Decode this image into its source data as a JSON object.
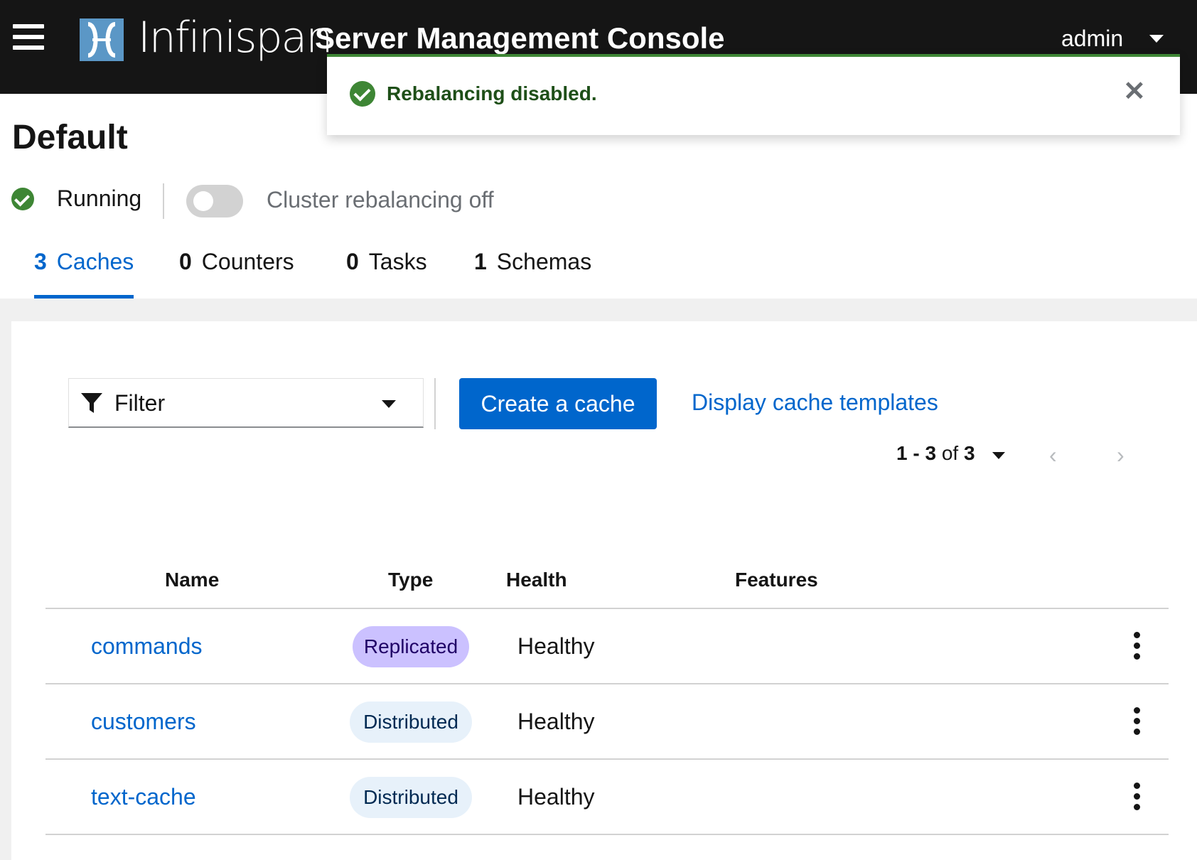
{
  "header": {
    "brand": "Infinispan",
    "title": "Server Management Console",
    "user": "admin",
    "menu_icon": "hamburger-icon",
    "logo_icon": "infinispan-logo-icon"
  },
  "alert": {
    "title": "Rebalancing disabled.",
    "close_symbol": "✕",
    "variant_color": "#3e8635"
  },
  "cluster": {
    "name": "Default",
    "status": "Running",
    "rebalancing_label": "Cluster rebalancing off",
    "rebalancing_enabled": false
  },
  "tabs": [
    {
      "count": "3",
      "label": "Caches",
      "active": true
    },
    {
      "count": "0",
      "label": "Counters",
      "active": false
    },
    {
      "count": "0",
      "label": "Tasks",
      "active": false
    },
    {
      "count": "1",
      "label": "Schemas",
      "active": false
    }
  ],
  "toolbar": {
    "filter_label": "Filter",
    "create_label": "Create a cache",
    "templates_label": "Display cache templates"
  },
  "pagination": {
    "range": "1 - 3",
    "of_label": "of",
    "total": "3",
    "prev_symbol": "‹",
    "next_symbol": "›"
  },
  "table": {
    "columns": [
      "Name",
      "Type",
      "Health",
      "Features"
    ],
    "rows": [
      {
        "name": "commands",
        "type": "Replicated",
        "health": "Healthy",
        "features": ""
      },
      {
        "name": "customers",
        "type": "Distributed",
        "health": "Healthy",
        "features": ""
      },
      {
        "name": "text-cache",
        "type": "Distributed",
        "health": "Healthy",
        "features": ""
      }
    ]
  },
  "colors": {
    "header_bg": "#151515",
    "accent": "#0066cc",
    "success": "#3e8635",
    "replicated_badge": "#cbc1ff",
    "distributed_badge": "#e7f1fa"
  }
}
